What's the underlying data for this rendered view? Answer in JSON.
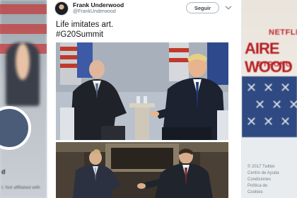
{
  "tweet": {
    "display_name": "Frank Underwood",
    "handle": "@FrankUnderwood",
    "follow_label": "Seguir",
    "text_line1": "Life imitates art.",
    "text_line2": "#G20Summit"
  },
  "background": {
    "right_banner_brand": "NETFLIX",
    "right_banner_title": "AIRE WOOD",
    "right_banner_tagline": "STRONG",
    "left_profile_name": "d",
    "left_profile_note": "t: Not affiliated with",
    "right_footer": [
      "© 2017 Twitter",
      "Centro de Ayuda",
      "Condiciones",
      "Política de",
      "Cookies"
    ]
  },
  "colors": {
    "brand_red": "#c1272d",
    "text_primary": "#14171a",
    "text_secondary": "#657786",
    "card_bg": "#ffffff"
  },
  "icons": {
    "avatar": "profile-photo",
    "menu": "chevron-down-icon"
  }
}
